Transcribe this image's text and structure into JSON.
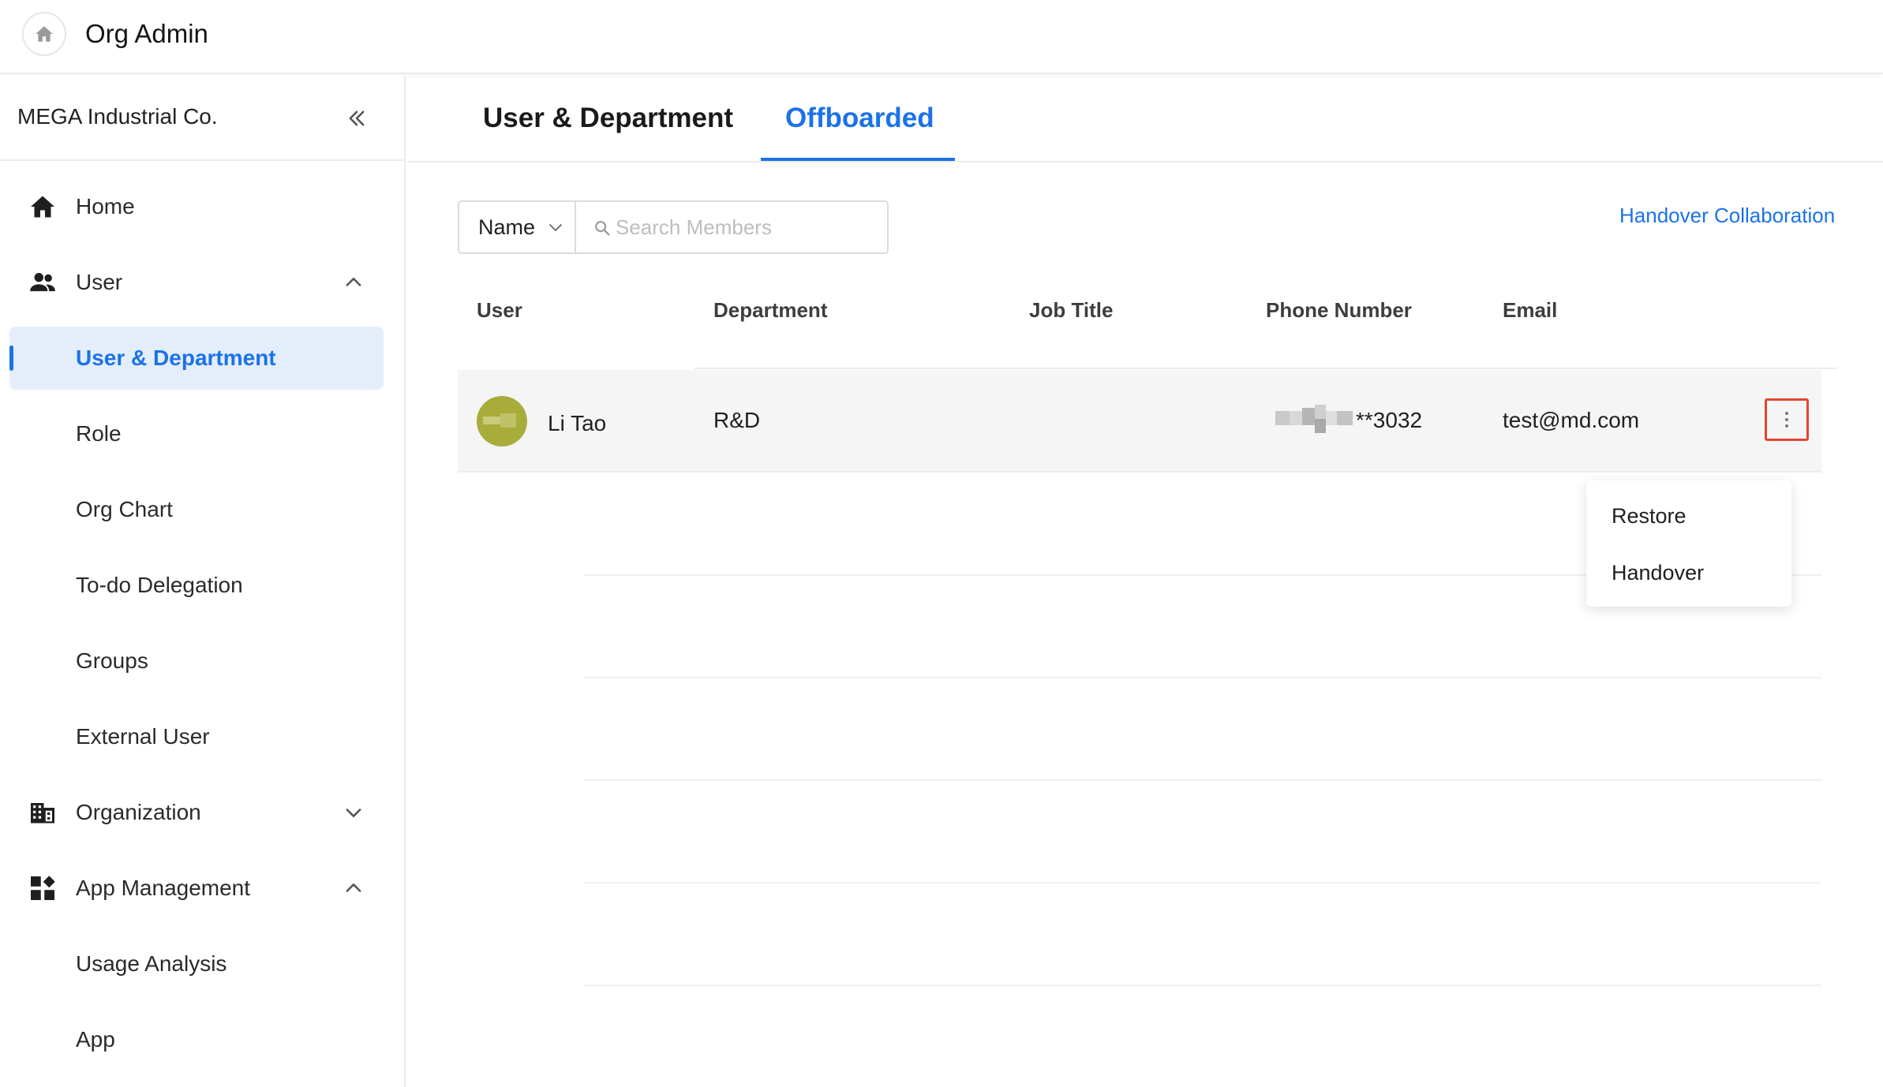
{
  "app": {
    "title": "Org Admin"
  },
  "sidebar": {
    "org_name": "MEGA Industrial Co.",
    "items": [
      {
        "label": "Home",
        "icon": "home-icon"
      },
      {
        "label": "User",
        "icon": "users-icon",
        "chevron": "chevron-up-icon"
      },
      {
        "label": "User & Department",
        "active": true
      },
      {
        "label": "Role"
      },
      {
        "label": "Org Chart"
      },
      {
        "label": "To-do Delegation"
      },
      {
        "label": "Groups"
      },
      {
        "label": "External User"
      },
      {
        "label": "Organization",
        "icon": "building-icon",
        "chevron": "chevron-down-icon"
      },
      {
        "label": "App Management",
        "icon": "apps-icon",
        "chevron": "chevron-up-icon"
      },
      {
        "label": "Usage Analysis"
      },
      {
        "label": "App"
      }
    ]
  },
  "tabs": [
    {
      "label": "User & Department"
    },
    {
      "label": "Offboarded",
      "active": true
    }
  ],
  "search": {
    "field_select": "Name",
    "placeholder": "Search Members",
    "value": ""
  },
  "handover_link": "Handover Collaboration",
  "table": {
    "columns": [
      "User",
      "Department",
      "Job Title",
      "Phone Number",
      "Email"
    ],
    "rows": [
      {
        "user": "Li Tao",
        "department": "R&D",
        "job_title": "",
        "phone": "**3032",
        "email": "test@md.com"
      }
    ]
  },
  "row_menu": {
    "items": [
      "Restore",
      "Handover"
    ]
  },
  "colors": {
    "accent": "#1b72e8",
    "active_bg": "#e4eefb",
    "highlight_border": "#e4452f",
    "avatar": "#a8ac3a"
  }
}
